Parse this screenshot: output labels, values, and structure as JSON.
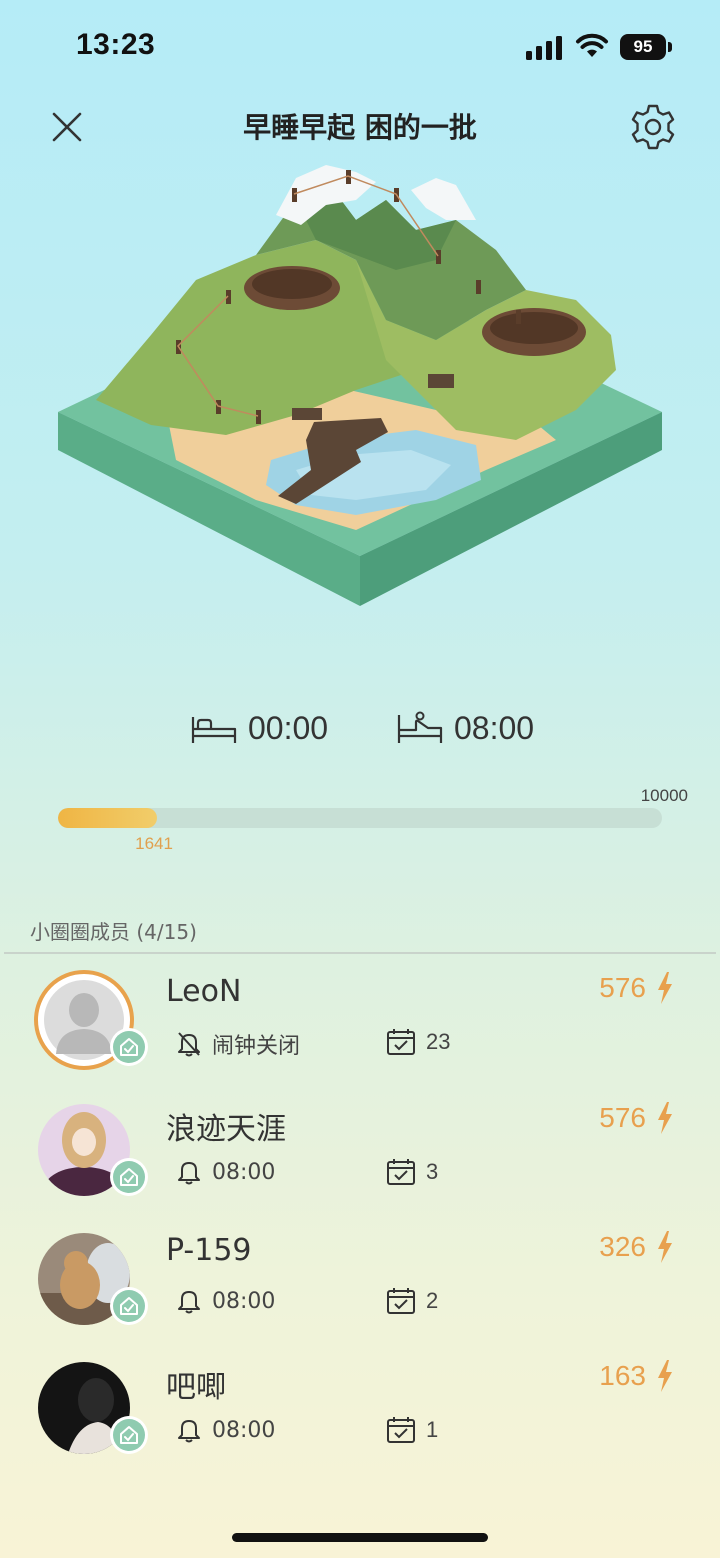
{
  "status_bar": {
    "time": "13:23",
    "battery": "95"
  },
  "header": {
    "title": "早睡早起 困的一批",
    "close_icon": "close-icon",
    "settings_icon": "gear-icon"
  },
  "schedule": {
    "bed_time": "00:00",
    "wake_time": "08:00"
  },
  "progress": {
    "current": "1641",
    "max": "10000",
    "fraction": 0.1641
  },
  "members": {
    "header": "小圈圈成员 (4/15)",
    "list": [
      {
        "name": "LeoN",
        "alarm": "闹钟关闭",
        "alarm_off": true,
        "days": "23",
        "energy": "576"
      },
      {
        "name": "浪迹天涯",
        "alarm": "08:00",
        "alarm_off": false,
        "days": "3",
        "energy": "576"
      },
      {
        "name": "P-159",
        "alarm": "08:00",
        "alarm_off": false,
        "days": "2",
        "energy": "326"
      },
      {
        "name": "吧唧",
        "alarm": "08:00",
        "alarm_off": false,
        "days": "1",
        "energy": "163"
      }
    ]
  },
  "colors": {
    "accent": "#e8a04e",
    "badge": "#8fcbb0",
    "progress_fill": "#efb544",
    "progress_track": "#c7dfd5"
  }
}
